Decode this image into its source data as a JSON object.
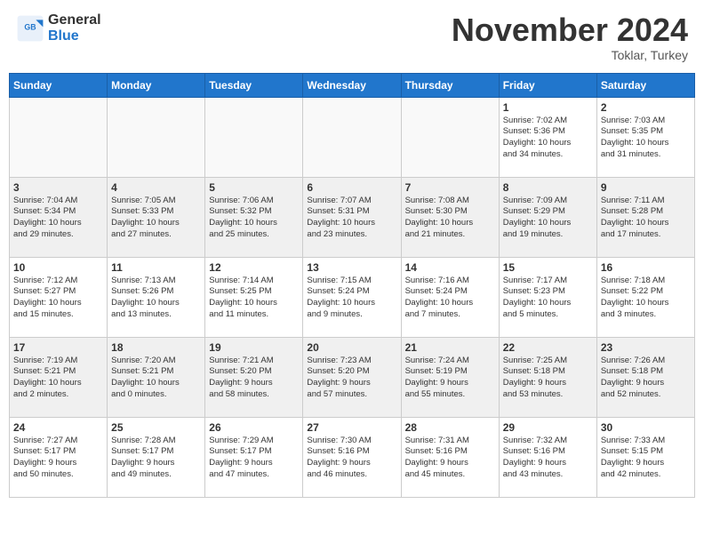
{
  "header": {
    "logo_general": "General",
    "logo_blue": "Blue",
    "month_title": "November 2024",
    "location": "Toklar, Turkey"
  },
  "weekdays": [
    "Sunday",
    "Monday",
    "Tuesday",
    "Wednesday",
    "Thursday",
    "Friday",
    "Saturday"
  ],
  "weeks": [
    [
      {
        "day": "",
        "info": ""
      },
      {
        "day": "",
        "info": ""
      },
      {
        "day": "",
        "info": ""
      },
      {
        "day": "",
        "info": ""
      },
      {
        "day": "",
        "info": ""
      },
      {
        "day": "1",
        "info": "Sunrise: 7:02 AM\nSunset: 5:36 PM\nDaylight: 10 hours\nand 34 minutes."
      },
      {
        "day": "2",
        "info": "Sunrise: 7:03 AM\nSunset: 5:35 PM\nDaylight: 10 hours\nand 31 minutes."
      }
    ],
    [
      {
        "day": "3",
        "info": "Sunrise: 7:04 AM\nSunset: 5:34 PM\nDaylight: 10 hours\nand 29 minutes."
      },
      {
        "day": "4",
        "info": "Sunrise: 7:05 AM\nSunset: 5:33 PM\nDaylight: 10 hours\nand 27 minutes."
      },
      {
        "day": "5",
        "info": "Sunrise: 7:06 AM\nSunset: 5:32 PM\nDaylight: 10 hours\nand 25 minutes."
      },
      {
        "day": "6",
        "info": "Sunrise: 7:07 AM\nSunset: 5:31 PM\nDaylight: 10 hours\nand 23 minutes."
      },
      {
        "day": "7",
        "info": "Sunrise: 7:08 AM\nSunset: 5:30 PM\nDaylight: 10 hours\nand 21 minutes."
      },
      {
        "day": "8",
        "info": "Sunrise: 7:09 AM\nSunset: 5:29 PM\nDaylight: 10 hours\nand 19 minutes."
      },
      {
        "day": "9",
        "info": "Sunrise: 7:11 AM\nSunset: 5:28 PM\nDaylight: 10 hours\nand 17 minutes."
      }
    ],
    [
      {
        "day": "10",
        "info": "Sunrise: 7:12 AM\nSunset: 5:27 PM\nDaylight: 10 hours\nand 15 minutes."
      },
      {
        "day": "11",
        "info": "Sunrise: 7:13 AM\nSunset: 5:26 PM\nDaylight: 10 hours\nand 13 minutes."
      },
      {
        "day": "12",
        "info": "Sunrise: 7:14 AM\nSunset: 5:25 PM\nDaylight: 10 hours\nand 11 minutes."
      },
      {
        "day": "13",
        "info": "Sunrise: 7:15 AM\nSunset: 5:24 PM\nDaylight: 10 hours\nand 9 minutes."
      },
      {
        "day": "14",
        "info": "Sunrise: 7:16 AM\nSunset: 5:24 PM\nDaylight: 10 hours\nand 7 minutes."
      },
      {
        "day": "15",
        "info": "Sunrise: 7:17 AM\nSunset: 5:23 PM\nDaylight: 10 hours\nand 5 minutes."
      },
      {
        "day": "16",
        "info": "Sunrise: 7:18 AM\nSunset: 5:22 PM\nDaylight: 10 hours\nand 3 minutes."
      }
    ],
    [
      {
        "day": "17",
        "info": "Sunrise: 7:19 AM\nSunset: 5:21 PM\nDaylight: 10 hours\nand 2 minutes."
      },
      {
        "day": "18",
        "info": "Sunrise: 7:20 AM\nSunset: 5:21 PM\nDaylight: 10 hours\nand 0 minutes."
      },
      {
        "day": "19",
        "info": "Sunrise: 7:21 AM\nSunset: 5:20 PM\nDaylight: 9 hours\nand 58 minutes."
      },
      {
        "day": "20",
        "info": "Sunrise: 7:23 AM\nSunset: 5:20 PM\nDaylight: 9 hours\nand 57 minutes."
      },
      {
        "day": "21",
        "info": "Sunrise: 7:24 AM\nSunset: 5:19 PM\nDaylight: 9 hours\nand 55 minutes."
      },
      {
        "day": "22",
        "info": "Sunrise: 7:25 AM\nSunset: 5:18 PM\nDaylight: 9 hours\nand 53 minutes."
      },
      {
        "day": "23",
        "info": "Sunrise: 7:26 AM\nSunset: 5:18 PM\nDaylight: 9 hours\nand 52 minutes."
      }
    ],
    [
      {
        "day": "24",
        "info": "Sunrise: 7:27 AM\nSunset: 5:17 PM\nDaylight: 9 hours\nand 50 minutes."
      },
      {
        "day": "25",
        "info": "Sunrise: 7:28 AM\nSunset: 5:17 PM\nDaylight: 9 hours\nand 49 minutes."
      },
      {
        "day": "26",
        "info": "Sunrise: 7:29 AM\nSunset: 5:17 PM\nDaylight: 9 hours\nand 47 minutes."
      },
      {
        "day": "27",
        "info": "Sunrise: 7:30 AM\nSunset: 5:16 PM\nDaylight: 9 hours\nand 46 minutes."
      },
      {
        "day": "28",
        "info": "Sunrise: 7:31 AM\nSunset: 5:16 PM\nDaylight: 9 hours\nand 45 minutes."
      },
      {
        "day": "29",
        "info": "Sunrise: 7:32 AM\nSunset: 5:16 PM\nDaylight: 9 hours\nand 43 minutes."
      },
      {
        "day": "30",
        "info": "Sunrise: 7:33 AM\nSunset: 5:15 PM\nDaylight: 9 hours\nand 42 minutes."
      }
    ]
  ]
}
